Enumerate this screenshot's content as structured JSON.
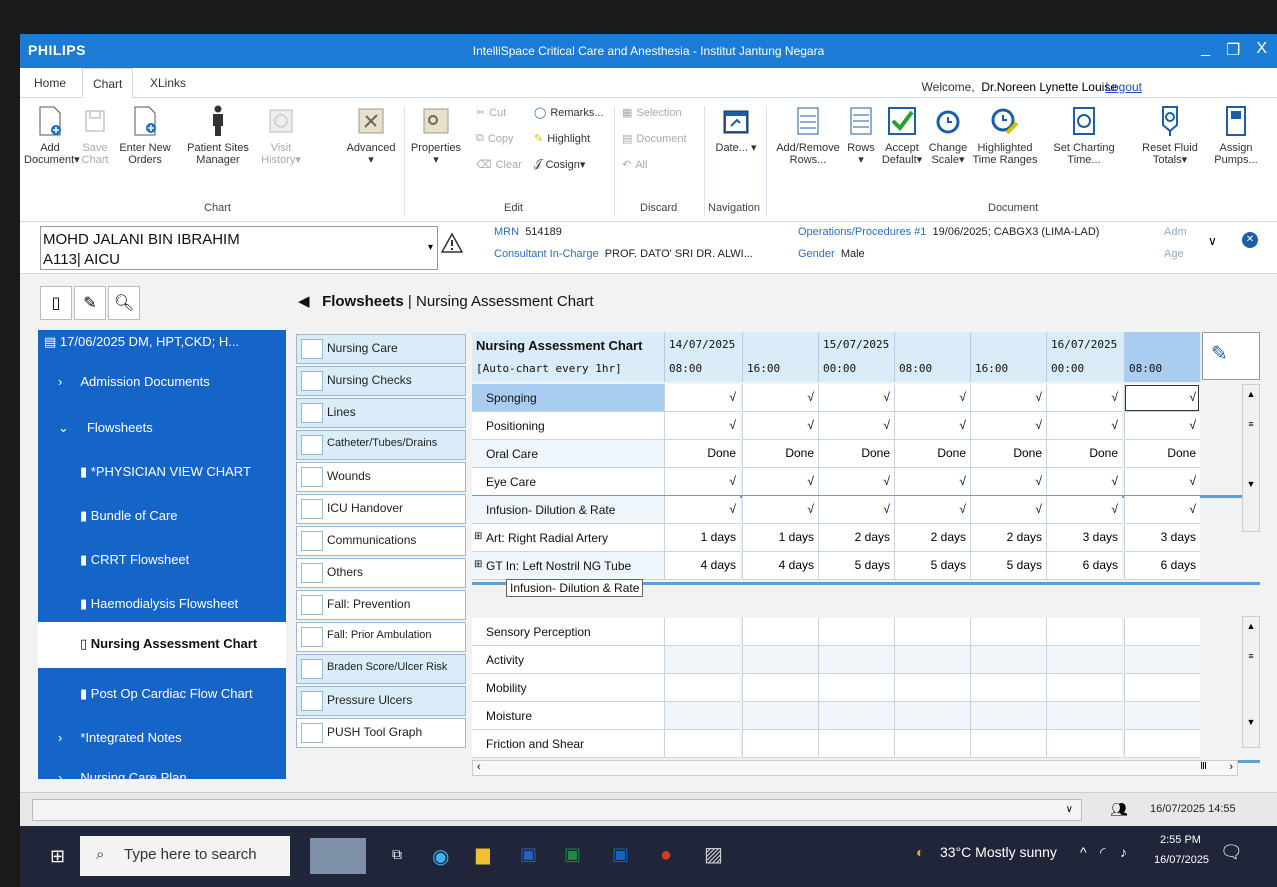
{
  "window": {
    "brand": "PHILIPS",
    "title": "IntelliSpace Critical Care and Anesthesia - Institut Jantung Negara",
    "controls": [
      "_",
      "❐",
      "X"
    ]
  },
  "menu_tabs": [
    "Home",
    "Chart",
    "XLinks"
  ],
  "welcome": {
    "prefix": "Welcome,",
    "user": "Dr.Noreen Lynette Louise",
    "logout": "Logout"
  },
  "ribbon": {
    "chart_group": {
      "label": "Chart",
      "buttons": [
        {
          "label": "Add Document▾"
        },
        {
          "label": "Save Chart"
        },
        {
          "label": "Enter New Orders"
        },
        {
          "label": "Patient Sites Manager"
        },
        {
          "label": "Visit History▾"
        },
        {
          "label": "Advanced ▾"
        }
      ]
    },
    "edit_group": {
      "label": "Edit",
      "properties": "Properties ▾",
      "cut": "Cut",
      "copy": "Copy",
      "clear": "Clear",
      "remarks": "Remarks...",
      "highlight": "Highlight",
      "cosign": "Cosign▾"
    },
    "discard_group": {
      "label": "Discard",
      "selection": "Selection",
      "document": "Document",
      "all": "All"
    },
    "navigation_group": {
      "label": "Navigation",
      "date": "Date... ▾"
    },
    "document_group": {
      "label": "Document",
      "buttons": [
        {
          "label": "Add/Remove Rows..."
        },
        {
          "label": "Rows ▾"
        },
        {
          "label": "Accept Default▾"
        },
        {
          "label": "Change Scale▾"
        },
        {
          "label": "Highlighted Time Ranges"
        },
        {
          "label": "Set Charting Time..."
        },
        {
          "label": "Reset Fluid Totals▾"
        },
        {
          "label": "Assign Pumps..."
        }
      ]
    }
  },
  "patient": {
    "name": "MOHD JALANI BIN IBRAHIM",
    "bed": "A113| AICU",
    "mrn_label": "MRN",
    "mrn": "514189",
    "consultant_label": "Consultant In-Charge",
    "consultant": "PROF. DATO' SRI DR. ALWI...",
    "ops_label": "Operations/Procedures #1",
    "ops": "19/06/2025; CABGX3 (LIMA-LAD)",
    "gender_label": "Gender",
    "gender": "Male",
    "adm_label": "Adm",
    "age_label": "Age"
  },
  "sidebar": {
    "header": "17/06/2025 DM, HPT,CKD; H...",
    "items": [
      {
        "label": "Admission Documents"
      },
      {
        "label": "Flowsheets"
      },
      {
        "label": "*PHYSICIAN VIEW CHART"
      },
      {
        "label": "Bundle of Care"
      },
      {
        "label": "CRRT Flowsheet"
      },
      {
        "label": "Haemodialysis Flowsheet"
      },
      {
        "label": "Nursing Assessment Chart"
      },
      {
        "label": "Post Op Cardiac Flow Chart"
      },
      {
        "label": "*Integrated Notes"
      },
      {
        "label": "Nursing Care Plan"
      }
    ]
  },
  "breadcrumb": {
    "section": "Flowsheets",
    "sep": " | ",
    "page": "Nursing Assessment Chart"
  },
  "subtabs": [
    "Nursing Care",
    "Nursing Checks",
    "Lines",
    "Catheter/Tubes/Drains",
    "Wounds",
    "ICU Handover",
    "Communications",
    "Others",
    "Fall: Prevention",
    "Fall: Prior Ambulation",
    "Braden Score/Ulcer Risk",
    "Pressure Ulcers",
    "PUSH Tool Graph"
  ],
  "grid": {
    "title": "Nursing Assessment Chart",
    "subtitle": "[Auto-chart every 1hr]",
    "dates": [
      "14/07/2025",
      "",
      "15/07/2025",
      "",
      "",
      "16/07/2025",
      ""
    ],
    "times": [
      "08:00",
      "16:00",
      "00:00",
      "08:00",
      "16:00",
      "00:00",
      "08:00"
    ],
    "rows_top": [
      {
        "label": "Sponging",
        "values": [
          "√",
          "√",
          "√",
          "√",
          "√",
          "√",
          "√"
        ]
      },
      {
        "label": "Positioning",
        "values": [
          "√",
          "√",
          "√",
          "√",
          "√",
          "√",
          "√"
        ]
      },
      {
        "label": "Oral Care",
        "values": [
          "Done",
          "Done",
          "Done",
          "Done",
          "Done",
          "Done",
          "Done"
        ]
      },
      {
        "label": "Eye Care",
        "values": [
          "√",
          "√",
          "√",
          "√",
          "√",
          "√",
          "√"
        ]
      },
      {
        "label": "Infusion- Dilution & Rate",
        "values": [
          "√",
          "√",
          "√",
          "√",
          "√",
          "√",
          "√"
        ]
      },
      {
        "label": "Art: Right Radial Artery",
        "values": [
          "1 days",
          "1 days",
          "2 days",
          "2 days",
          "2 days",
          "3 days",
          "3 days"
        ]
      },
      {
        "label": "GT In: Left Nostril NG Tube",
        "values": [
          "4 days",
          "4 days",
          "5 days",
          "5 days",
          "5 days",
          "6 days",
          "6 days"
        ]
      }
    ],
    "rows_bottom": [
      "Sensory Perception",
      "Activity",
      "Mobility",
      "Moisture",
      "Friction and Shear"
    ],
    "tooltip": "Infusion- Dilution & Rate"
  },
  "status": {
    "datetime": "16/07/2025 14:55"
  },
  "taskbar": {
    "search_placeholder": "Type here to search",
    "weather": "33°C  Mostly sunny",
    "time": "2:55 PM",
    "date": "16/07/2025"
  }
}
